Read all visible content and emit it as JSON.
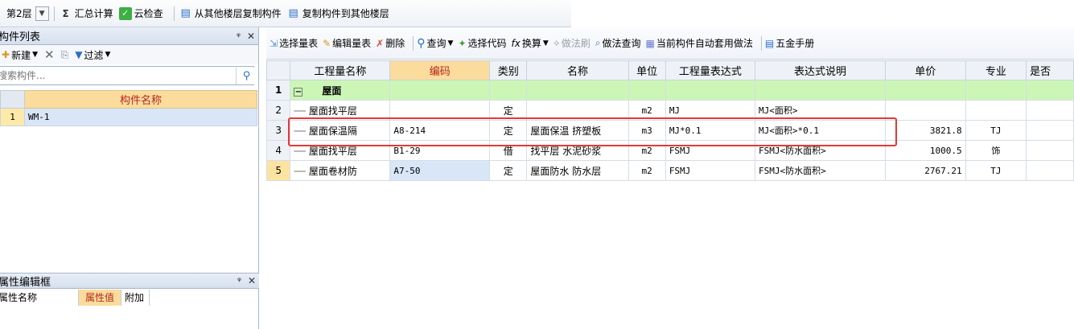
{
  "toolbar": {
    "floor": "第2层",
    "summary_calc": "汇总计算",
    "cloud_check": "云检查",
    "copy_from_floor": "从其他楼层复制构件",
    "copy_to_floor": "复制构件到其他楼层"
  },
  "left": {
    "component_list_title": "构件列表",
    "new_label": "新建",
    "filter_label": "过滤",
    "search_placeholder": "搜索构件...",
    "col_header": "构件名称",
    "rows": [
      {
        "index": "1",
        "name": "WM-1"
      }
    ],
    "prop_title": "属性编辑框",
    "prop_cols": [
      "属性名称",
      "属性值",
      "附加"
    ]
  },
  "right": {
    "tools": {
      "select_table": "选择量表",
      "edit_table": "编辑量表",
      "delete": "删除",
      "query": "查询",
      "select_code": "选择代码",
      "convert": "换算",
      "method_brush": "做法刷",
      "method_query": "做法查询",
      "auto_apply": "当前构件自动套用做法",
      "manual": "五金手册"
    },
    "headers": [
      "工程量名称",
      "编码",
      "类别",
      "名称",
      "单位",
      "工程量表达式",
      "表达式说明",
      "单价",
      "专业",
      "是否"
    ],
    "section": {
      "index": "1",
      "expander": "−",
      "name": "屋面"
    },
    "rows": [
      {
        "index": "2",
        "name": "屋面找平层",
        "code": "",
        "category": "定",
        "item": "",
        "unit": "m2",
        "expr": "MJ",
        "desc": "MJ<面积>",
        "price": "",
        "major": ""
      },
      {
        "index": "3",
        "name": "屋面保温隔",
        "code": "A8-214",
        "category": "定",
        "item": "屋面保温 挤塑板",
        "unit": "m3",
        "expr": "MJ*0.1",
        "desc": "MJ<面积>*0.1",
        "price": "3821.8",
        "major": "TJ"
      },
      {
        "index": "4",
        "name": "屋面找平层",
        "code": "B1-29",
        "category": "借",
        "item": "找平层 水泥砂浆",
        "unit": "m2",
        "expr": "FSMJ",
        "desc": "FSMJ<防水面积>",
        "price": "1000.5",
        "major": "饰"
      },
      {
        "index": "5",
        "name": "屋面卷材防",
        "code": "A7-50",
        "category": "定",
        "item": "屋面防水 防水层",
        "unit": "m2",
        "expr": "FSMJ",
        "desc": "FSMJ<防水面积>",
        "price": "2767.21",
        "major": "TJ"
      }
    ]
  }
}
